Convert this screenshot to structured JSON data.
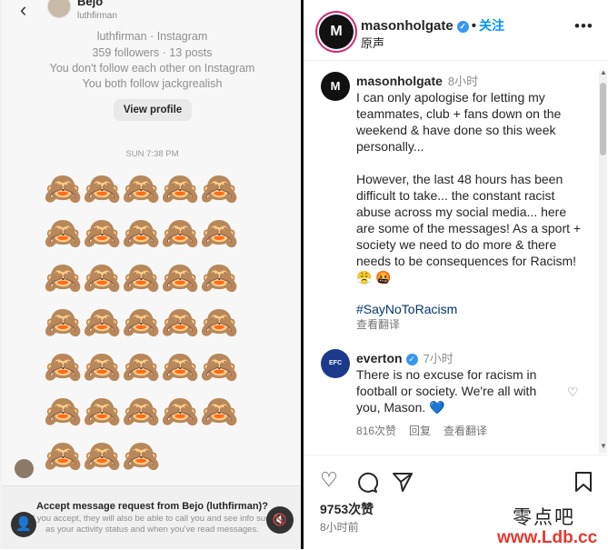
{
  "dm": {
    "name": "Bejo",
    "handle": "luthfirman",
    "profile_lines": [
      "luthfirman · Instagram",
      "359 followers · 13 posts",
      "You don't follow each other on Instagram",
      "You both follow jackgrealish"
    ],
    "view_profile_label": "View profile",
    "time_label": "SUN 7:38 PM",
    "monkey_rows": [
      [
        "🙈",
        "🙈",
        "🙈",
        "🙈",
        "🙈"
      ],
      [
        "🙈",
        "🙈",
        "🙈",
        "🙈",
        "🙈"
      ],
      [
        "🙈",
        "🙈",
        "🙈",
        "🙈",
        "🙈"
      ],
      [
        "🙈",
        "🙈",
        "🙈",
        "🙈",
        "🙈"
      ],
      [
        "🙈",
        "🙈",
        "🙈",
        "🙈",
        "🙈"
      ],
      [
        "🙈",
        "🙈",
        "🙈",
        "🙈",
        "🙈"
      ],
      [
        "🙈",
        "🙈",
        "🙈"
      ]
    ],
    "request_title": "Accept message request from Bejo (luthfirman)?",
    "request_body": "If you accept, they will also be able to call you and see info such as your activity status and when you've read messages.",
    "profile_button_icon": "person-icon",
    "mute_button_icon": "mute-icon"
  },
  "post": {
    "logo_text": "M",
    "username": "masonholgate",
    "follow_label": "关注",
    "subtitle": "原声",
    "more_icon": "more-icon",
    "caption": {
      "username": "masonholgate",
      "time": "8小时",
      "para1": "I can only apologise for letting my teammates, club + fans down on the weekend & have done so this week personally...",
      "para2": "However, the last 48 hours has been difficult to take... the constant racist abuse across my social media... here are some of the messages! As a sport + society we need to do more & there needs to be consequences for Racism! 😤 🤬",
      "hashtag": "#SayNoToRacism",
      "translate": "查看翻译"
    },
    "comment": {
      "logo_text": "EFC",
      "username": "everton",
      "time": "7小时",
      "text": "There is no excuse for racism in football or society. We're all with you, Mason. 💙",
      "likes": "816次赞",
      "reply": "回复",
      "translate": "查看翻译"
    },
    "likes": "9753次赞",
    "time_ago": "8小时前"
  },
  "watermark": {
    "cn": "零点吧",
    "url": "www.Ldb.cc"
  }
}
